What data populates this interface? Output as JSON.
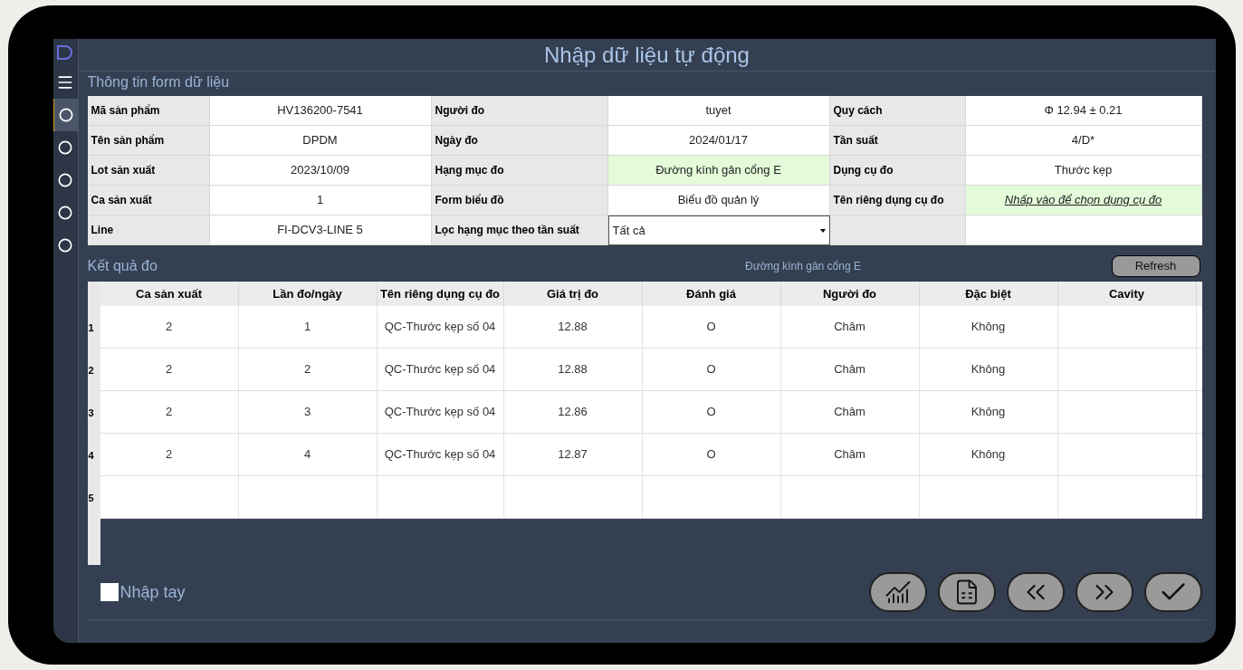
{
  "window": {
    "title": "Nhập dữ liệu tự động"
  },
  "sidebar": {
    "items": [
      {
        "selected": true
      },
      {
        "selected": false
      },
      {
        "selected": false
      },
      {
        "selected": false
      },
      {
        "selected": false
      }
    ]
  },
  "form": {
    "title": "Thông tin form dữ liệu",
    "fields": [
      {
        "kind": "text",
        "label": "Mã sản phẩm",
        "value": "HV136200-7541",
        "highlighted": false
      },
      {
        "kind": "text",
        "label": "Người đo",
        "value": "tuyet",
        "highlighted": false
      },
      {
        "kind": "text",
        "label": "Quy cách",
        "value": "Φ 12.94 ± 0.21",
        "highlighted": false
      },
      {
        "kind": "text",
        "label": "Tên sản phẩm",
        "value": "DPDM",
        "highlighted": false
      },
      {
        "kind": "text",
        "label": "Ngày đo",
        "value": "2024/01/17",
        "highlighted": false
      },
      {
        "kind": "text",
        "label": "Tần suất",
        "value": "4/D*",
        "highlighted": false
      },
      {
        "kind": "text",
        "label": "Lot sản xuất",
        "value": "2023/10/09",
        "highlighted": false
      },
      {
        "kind": "text",
        "label": "Hạng mục đo",
        "value": "Đường kính gân cổng E",
        "highlighted": true
      },
      {
        "kind": "text",
        "label": "Dụng cụ đo",
        "value": "Thước kẹp",
        "highlighted": false
      },
      {
        "kind": "text",
        "label": "Ca sản xuất",
        "value": "1",
        "highlighted": false
      },
      {
        "kind": "text",
        "label": "Form biểu đồ",
        "value": "Biểu đồ quản lý",
        "highlighted": false
      },
      {
        "kind": "link",
        "label": "Tên riêng dụng cụ đo",
        "value": "Nhấp vào để chọn dụng cụ đo",
        "highlighted": true
      },
      {
        "kind": "text",
        "label": "Line",
        "value": "FI-DCV3-LINE 5",
        "highlighted": false
      },
      {
        "kind": "select",
        "label": "Lọc hạng mục theo tần suất",
        "value": "Tất cả",
        "highlighted": false
      },
      {
        "kind": "blank",
        "highlighted": false
      }
    ]
  },
  "results": {
    "title": "Kết quả đo",
    "subtitle": "Đường kính gân cổng E",
    "refresh": "Refresh",
    "columns": [
      "Ca sản xuất",
      "Lần đo/ngày",
      "Tên riêng dụng cụ đo",
      "Giá trị đo",
      "Đánh giá",
      "Người đo",
      "Đặc biệt",
      "Cavity"
    ],
    "rows": [
      {
        "index": "1",
        "cells": [
          "2",
          "1",
          "QC-Thước kẹp số 04",
          "12.88",
          "O",
          "Châm",
          "Không"
        ]
      },
      {
        "index": "2",
        "cells": [
          "2",
          "2",
          "QC-Thước kẹp số 04",
          "12.88",
          "O",
          "Châm",
          "Không"
        ]
      },
      {
        "index": "3",
        "cells": [
          "2",
          "3",
          "QC-Thước kẹp số 04",
          "12.86",
          "O",
          "Châm",
          "Không"
        ]
      },
      {
        "index": "4",
        "cells": [
          "2",
          "4",
          "QC-Thước kẹp số 04",
          "12.87",
          "O",
          "Châm",
          "Không"
        ]
      },
      {
        "index": "5",
        "cells": []
      }
    ]
  },
  "manual_entry": {
    "label": "Nhập tay",
    "checked": false
  },
  "actions": [
    {
      "kind": "chart"
    },
    {
      "kind": "document"
    },
    {
      "kind": "previous"
    },
    {
      "kind": "next"
    },
    {
      "kind": "confirm"
    }
  ]
}
